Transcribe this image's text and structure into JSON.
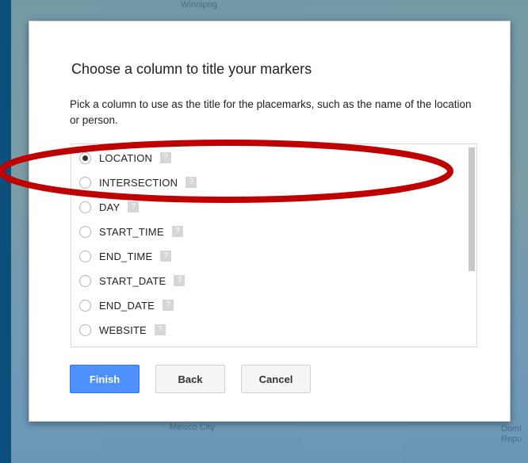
{
  "map": {
    "labels": [
      "Winnipeg",
      "Mexico City",
      "Domi",
      "Repu"
    ]
  },
  "dialog": {
    "title": "Choose a column to title your markers",
    "description": "Pick a column to use as the title for the placemarks, such as the name of the location or person.",
    "help_icon": "?",
    "options": [
      {
        "label": "LOCATION",
        "selected": true
      },
      {
        "label": "INTERSECTION",
        "selected": false
      },
      {
        "label": "DAY",
        "selected": false
      },
      {
        "label": "START_TIME",
        "selected": false
      },
      {
        "label": "END_TIME",
        "selected": false
      },
      {
        "label": "START_DATE",
        "selected": false
      },
      {
        "label": "END_DATE",
        "selected": false
      },
      {
        "label": "WEBSITE",
        "selected": false
      }
    ],
    "buttons": {
      "finish": "Finish",
      "back": "Back",
      "cancel": "Cancel"
    }
  },
  "colors": {
    "primary_button": "#4d90fe",
    "annotation_ellipse": "#c00000",
    "frame": "#0b4f7c"
  }
}
